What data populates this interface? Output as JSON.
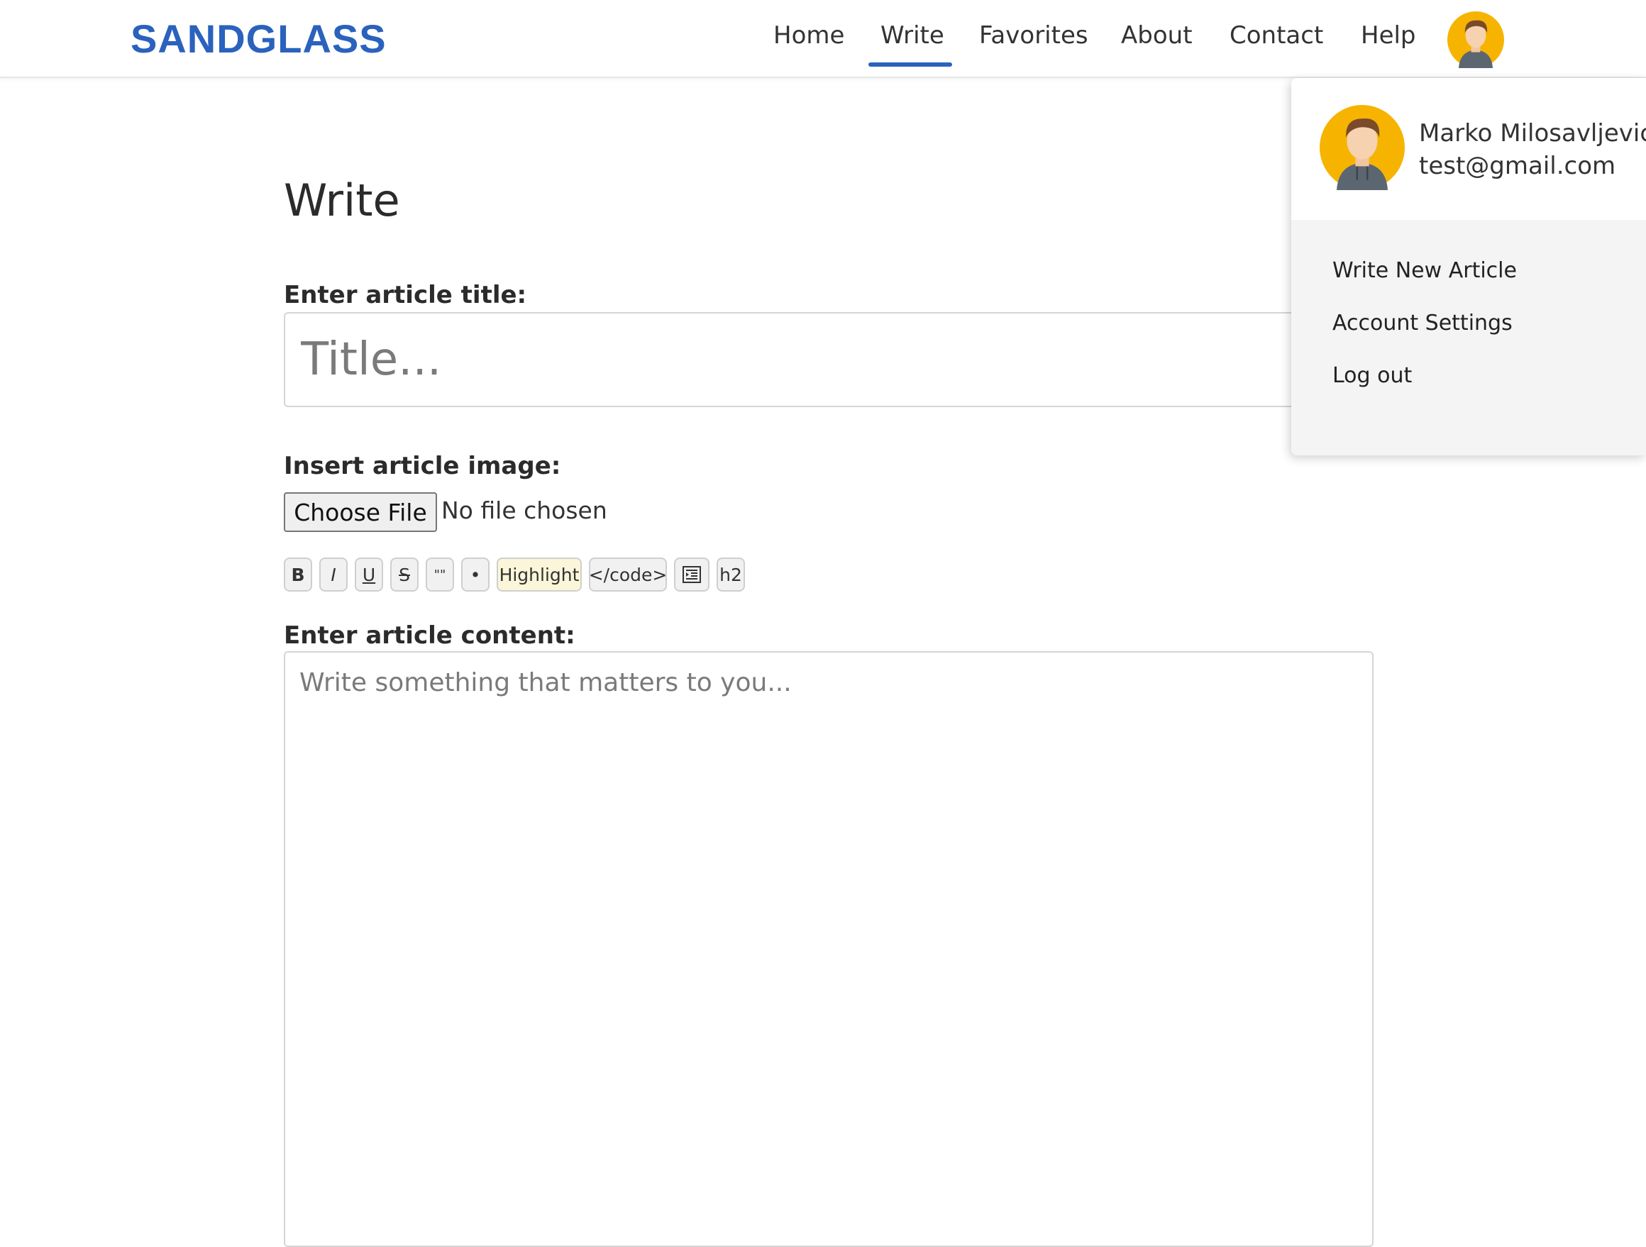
{
  "brand": {
    "logo": "SANDGLASS",
    "accent_color": "#2a62bd"
  },
  "nav": {
    "items": [
      {
        "label": "Home"
      },
      {
        "label": "Write",
        "active": true
      },
      {
        "label": "Favorites"
      },
      {
        "label": "About"
      },
      {
        "label": "Contact"
      },
      {
        "label": "Help"
      }
    ],
    "avatar_icon": "user-avatar-icon"
  },
  "page": {
    "title": "Write",
    "title_label": "Enter article title:",
    "title_placeholder": "Title...",
    "image_label": "Insert article image:",
    "file_button": "Choose File",
    "file_status": "No file chosen",
    "content_label": "Enter article content:",
    "content_placeholder": "Write something that matters to you..."
  },
  "toolbar": {
    "bold": "B",
    "italic": "I",
    "underline": "U",
    "strike": "S",
    "quote": "\"\"",
    "bullet": "•",
    "highlight": "Highlight",
    "code": "</code>",
    "indent_icon": "indent-icon",
    "h2": "h2"
  },
  "user_menu": {
    "name": "Marko Milosavljevic",
    "email": "test@gmail.com",
    "items": [
      {
        "label": "Write New Article"
      },
      {
        "label": "Account Settings"
      },
      {
        "label": "Log out"
      }
    ]
  }
}
